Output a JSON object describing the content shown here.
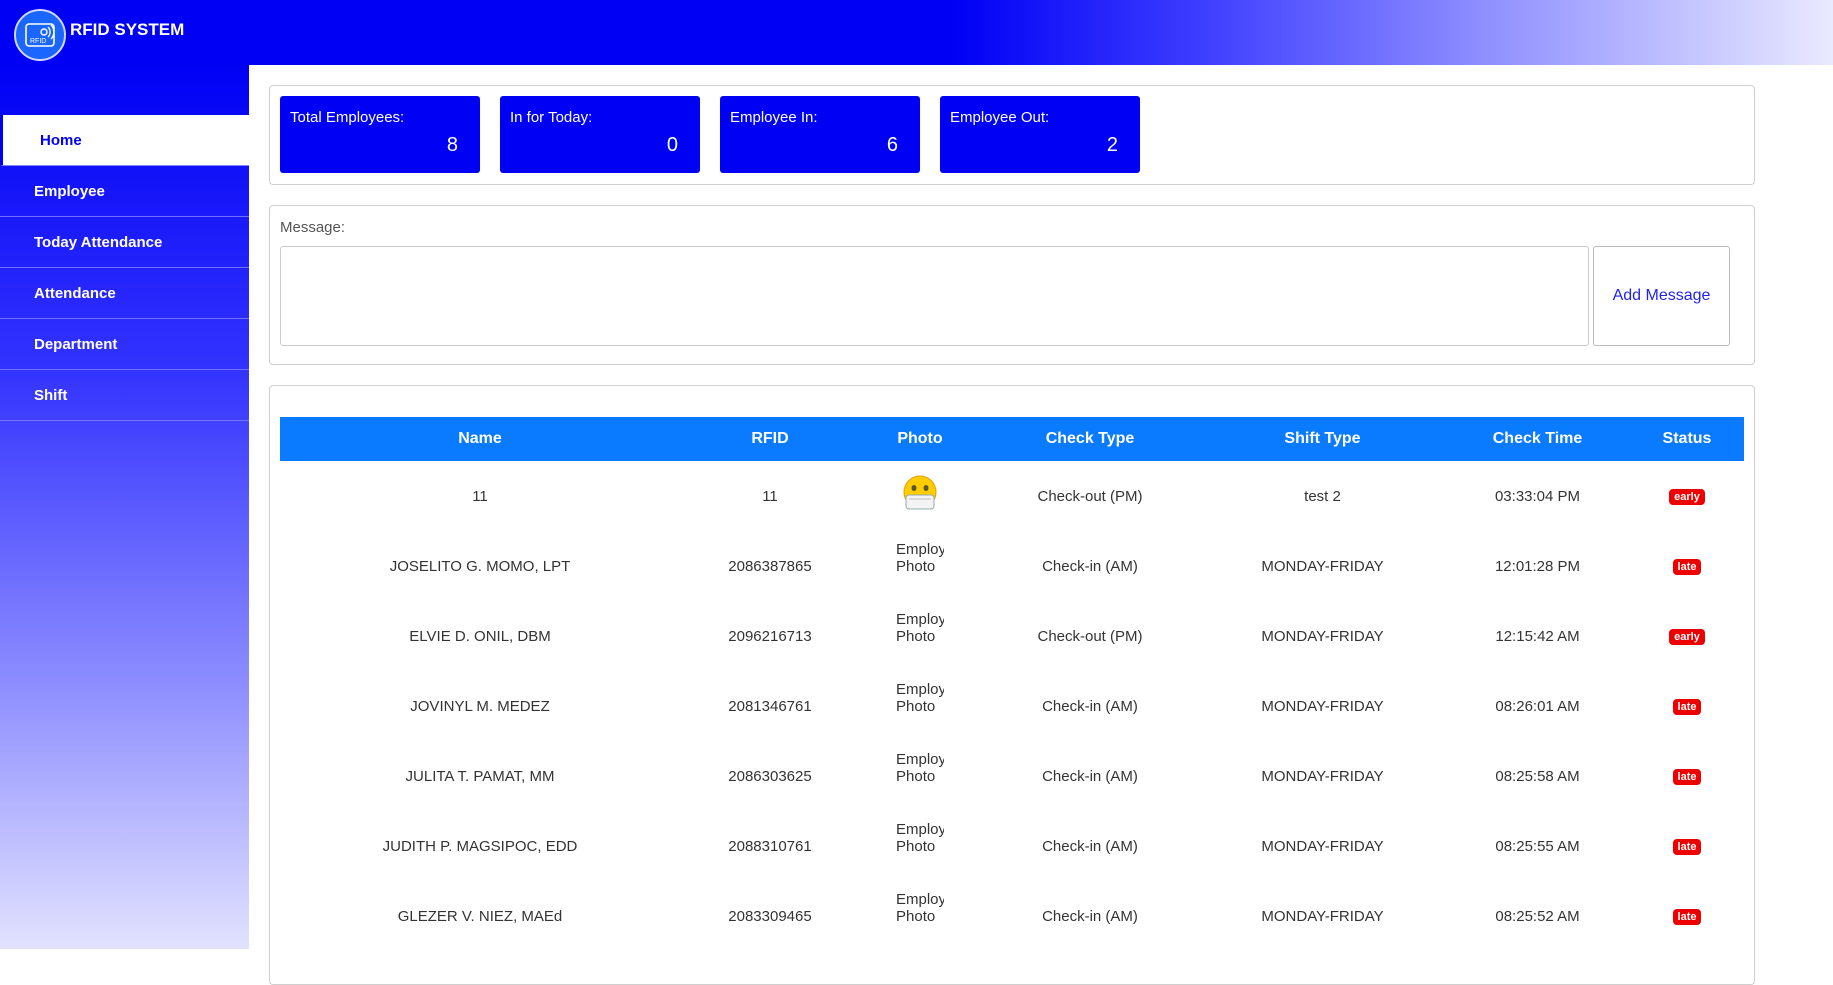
{
  "app": {
    "title": "RFID SYSTEM",
    "logo_text": "RFID"
  },
  "sidebar": {
    "items": [
      {
        "label": "Home",
        "active": true
      },
      {
        "label": "Employee"
      },
      {
        "label": "Today Attendance"
      },
      {
        "label": "Attendance"
      },
      {
        "label": "Department"
      },
      {
        "label": "Shift"
      }
    ]
  },
  "stats": [
    {
      "label": "Total Employees:",
      "value": "8"
    },
    {
      "label": "In for Today:",
      "value": "0"
    },
    {
      "label": "Employee In:",
      "value": "6"
    },
    {
      "label": "Employee Out:",
      "value": "2"
    }
  ],
  "message": {
    "label": "Message:",
    "value": "",
    "button": "Add Message"
  },
  "table": {
    "headers": [
      "Name",
      "RFID",
      "Photo",
      "Check Type",
      "Shift Type",
      "Check Time",
      "Status"
    ],
    "broken_photo_alt": "Employee Photo",
    "rows": [
      {
        "name": "11",
        "rfid": "11",
        "photo": "emoji",
        "check_type": "Check-out (PM)",
        "shift_type": "test 2",
        "check_time": "03:33:04 PM",
        "status": "early"
      },
      {
        "name": "JOSELITO G. MOMO, LPT",
        "rfid": "2086387865",
        "photo": "broken",
        "check_type": "Check-in (AM)",
        "shift_type": "MONDAY-FRIDAY",
        "check_time": "12:01:28 PM",
        "status": "late"
      },
      {
        "name": "ELVIE D. ONIL, DBM",
        "rfid": "2096216713",
        "photo": "broken",
        "check_type": "Check-out (PM)",
        "shift_type": "MONDAY-FRIDAY",
        "check_time": "12:15:42 AM",
        "status": "early"
      },
      {
        "name": "JOVINYL M. MEDEZ",
        "rfid": "2081346761",
        "photo": "broken",
        "check_type": "Check-in (AM)",
        "shift_type": "MONDAY-FRIDAY",
        "check_time": "08:26:01 AM",
        "status": "late"
      },
      {
        "name": "JULITA T. PAMAT, MM",
        "rfid": "2086303625",
        "photo": "broken",
        "check_type": "Check-in (AM)",
        "shift_type": "MONDAY-FRIDAY",
        "check_time": "08:25:58 AM",
        "status": "late"
      },
      {
        "name": "JUDITH P. MAGSIPOC, EDD",
        "rfid": "2088310761",
        "photo": "broken",
        "check_type": "Check-in (AM)",
        "shift_type": "MONDAY-FRIDAY",
        "check_time": "08:25:55 AM",
        "status": "late"
      },
      {
        "name": "GLEZER V. NIEZ, MAEd",
        "rfid": "2083309465",
        "photo": "broken",
        "check_type": "Check-in (AM)",
        "shift_type": "MONDAY-FRIDAY",
        "check_time": "08:25:52 AM",
        "status": "late"
      }
    ]
  },
  "colors": {
    "primary": "#0000f5",
    "table_header": "#0a7bff",
    "badge": "#ee0000"
  }
}
